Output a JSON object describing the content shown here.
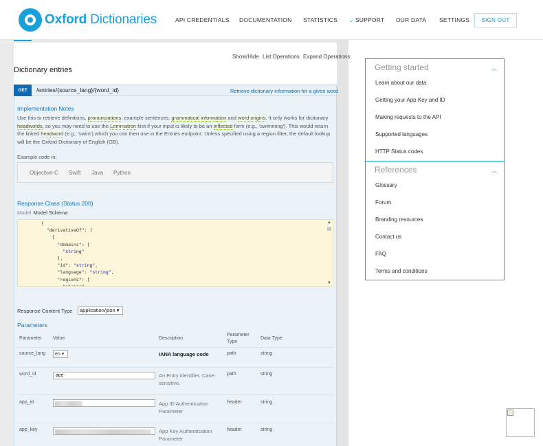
{
  "header": {
    "logo_bold": "Oxford",
    "logo_light": " Dictionaries",
    "nav": [
      "API CREDENTIALS",
      "DOCUMENTATION",
      "STATISTICS",
      "SUPPORT",
      "OUR DATA",
      "SETTINGS"
    ],
    "signout": "SIGN OUT"
  },
  "ops": {
    "show_hide": "Show/Hide",
    "list": "List Operations",
    "expand": "Expand Operations"
  },
  "section_title": "Dictionary entries",
  "endpoint": {
    "method": "GET",
    "path": "/entries/{source_lang}/{word_id}",
    "description": "Retrieve dictionary information for a given word"
  },
  "implementation": {
    "title": "Implementation Notes",
    "t1": "Use this to retrieve definitions, ",
    "h1": "pronunciations",
    "t2": ", example sentences, ",
    "h2": "grammatical information",
    "t3": " and ",
    "h3": "word origins",
    "t4": ". It only works for dictionary ",
    "h4": "headwords",
    "t5": ", so you may need to use the ",
    "h5": "Lemmatron",
    "t6": " first if your input is likely to be an ",
    "h6": "inflected",
    "t7": " form (e.g., 'swimming'). This would return the linked ",
    "h7": "headword",
    "t8": " (e.g., 'swim') which you can then use in the Entries endpoint. Unless specified using a region filter, the default lookup will be the Oxford Dictionary of English (GB)."
  },
  "example": {
    "label": "Example code in:",
    "tabs": [
      "Objective-C",
      "Swift",
      "Java",
      "Python"
    ]
  },
  "response_class": {
    "title": "Response Class (Status 200)",
    "model": "Model",
    "schema_label": "Model Schema"
  },
  "response_content_type": {
    "label": "Response Content Type",
    "value": "application/json"
  },
  "parameters": {
    "title": "Parameters",
    "headers": [
      "Parameter",
      "Value",
      "Description",
      "Parameter Type",
      "Data Type"
    ],
    "rows": [
      {
        "name": "source_lang",
        "value": "en",
        "description": "IANA language code",
        "ptype": "path",
        "dtype": "string"
      },
      {
        "name": "word_id",
        "value": "ace",
        "description": "An Entry identifier. Case-sensitive.",
        "ptype": "path",
        "dtype": "string"
      },
      {
        "name": "app_id",
        "value": "",
        "description": "App ID Authentication Parameter",
        "ptype": "header",
        "dtype": "string"
      },
      {
        "name": "app_key",
        "value": "",
        "description": "App Key Authentication Parameter",
        "ptype": "header",
        "dtype": "string"
      }
    ]
  },
  "sidebar": {
    "getting_started": {
      "title": "Getting started",
      "items": [
        "Learn about our data",
        "Getting your App Key and ID",
        "Making requests to the API",
        "Supported languages",
        "HTTP Status codes"
      ]
    },
    "references": {
      "title": "References",
      "items": [
        "Glossary",
        "Forum",
        "Branding resources",
        "Contact us",
        "FAQ",
        "Terms and conditions"
      ]
    }
  },
  "colors": {
    "brand": "#1aa1d9",
    "get_badge": "#0f6ab4",
    "schema_bg": "#fcf6db"
  }
}
